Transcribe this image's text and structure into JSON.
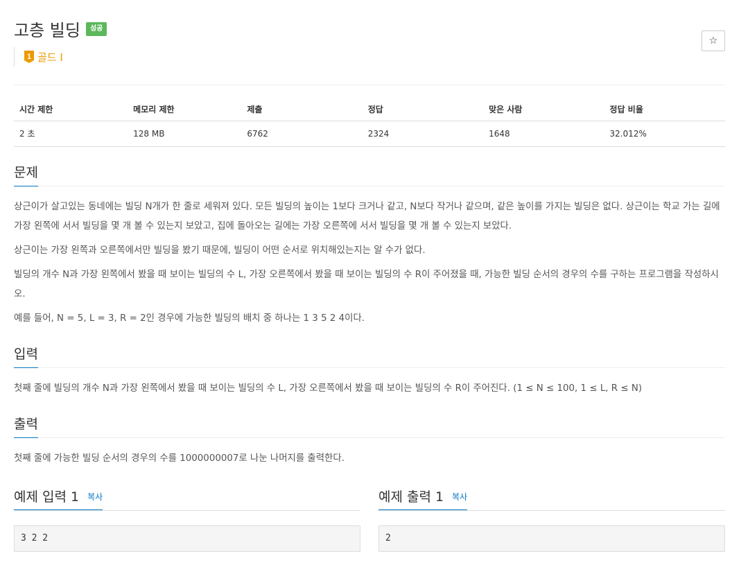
{
  "problem": {
    "title": "고층 빌딩",
    "status_badge": "성공",
    "tier_label": "골드 I",
    "tier_number": "1",
    "star_icon": "☆",
    "tier_color": "#ec9a00"
  },
  "info_table": {
    "headers": [
      "시간 제한",
      "메모리 제한",
      "제출",
      "정답",
      "맞은 사람",
      "정답 비율"
    ],
    "values": [
      "2 초",
      "128 MB",
      "6762",
      "2324",
      "1648",
      "32.012%"
    ]
  },
  "sections": {
    "description": {
      "title": "문제",
      "paragraphs": [
        "상근이가 살고있는 동네에는 빌딩 N개가 한 줄로 세워져 있다. 모든 빌딩의 높이는 1보다 크거나 같고, N보다 작거나 같으며, 같은 높이를 가지는 빌딩은 없다. 상근이는 학교 가는 길에 가장 왼쪽에 서서 빌딩을 몇 개 볼 수 있는지 보았고, 집에 돌아오는 길에는 가장 오른쪽에 서서 빌딩을 몇 개 볼 수 있는지 보았다.",
        "상근이는 가장 왼쪽과 오른쪽에서만 빌딩을 봤기 때문에, 빌딩이 어떤 순서로 위치해있는지는 알 수가 없다.",
        "빌딩의 개수 N과 가장 왼쪽에서 봤을 때 보이는 빌딩의 수 L, 가장 오른쪽에서 봤을 때 보이는 빌딩의 수 R이 주어졌을 때, 가능한 빌딩 순서의 경우의 수를 구하는 프로그램을 작성하시오.",
        "예를 들어, N = 5, L = 3, R = 2인 경우에 가능한 빌딩의 배치 중 하나는 1 3 5 2 4이다."
      ]
    },
    "input": {
      "title": "입력",
      "paragraphs": [
        "첫째 줄에 빌딩의 개수 N과 가장 왼쪽에서 봤을 때 보이는 빌딩의 수 L, 가장 오른쪽에서 봤을 때 보이는 빌딩의 수 R이 주어진다. (1 ≤ N ≤ 100, 1 ≤ L, R ≤ N)"
      ]
    },
    "output": {
      "title": "출력",
      "paragraphs": [
        "첫째 줄에 가능한 빌딩 순서의 경우의 수를 1000000007로 나눈 나머지를 출력한다."
      ]
    }
  },
  "samples": {
    "input": {
      "title": "예제 입력 1",
      "copy_label": "복사",
      "content": "3 2 2"
    },
    "output": {
      "title": "예제 출력 1",
      "copy_label": "복사",
      "content": "2"
    }
  }
}
